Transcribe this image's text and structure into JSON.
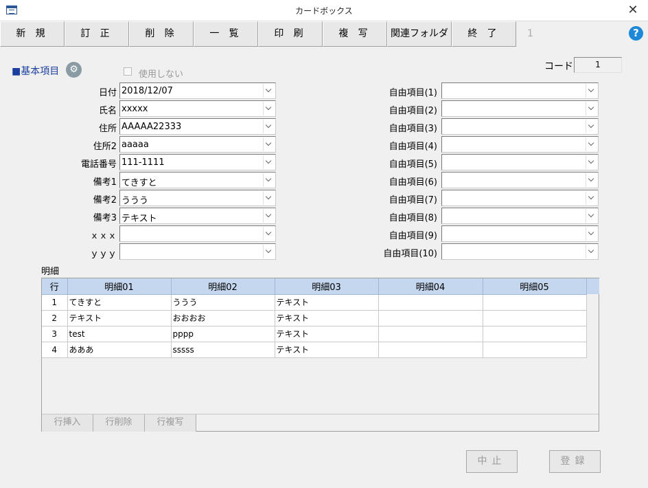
{
  "window": {
    "title": "カードボックス",
    "close_symbol": "✕"
  },
  "toolbar": {
    "buttons": [
      "新 規",
      "訂 正",
      "削 除",
      "一 覧",
      "印 刷",
      "複 写",
      "関連フォルダ",
      "終 了"
    ],
    "record_number": "1",
    "help_symbol": "?"
  },
  "section": {
    "title": "■基本項目",
    "gear_symbol": "⚙",
    "unused_label": "使用しない",
    "code_label": "コード",
    "code_value": "1"
  },
  "left_fields": [
    {
      "label": "日付",
      "value": "2018/12/07"
    },
    {
      "label": "氏名",
      "value": "xxxxx"
    },
    {
      "label": "住所",
      "value": "AAAAA22333"
    },
    {
      "label": "住所2",
      "value": "aaaaa"
    },
    {
      "label": "電話番号",
      "value": "111-1111"
    },
    {
      "label": "備考1",
      "value": "てきすと"
    },
    {
      "label": "備考2",
      "value": "ううう"
    },
    {
      "label": "備考3",
      "value": "テキスト"
    },
    {
      "label": "ｘｘｘ",
      "value": ""
    },
    {
      "label": "ｙｙｙ",
      "value": ""
    }
  ],
  "right_fields": [
    {
      "label": "自由項目(1)",
      "value": ""
    },
    {
      "label": "自由項目(2)",
      "value": ""
    },
    {
      "label": "自由項目(3)",
      "value": ""
    },
    {
      "label": "自由項目(4)",
      "value": ""
    },
    {
      "label": "自由項目(5)",
      "value": ""
    },
    {
      "label": "自由項目(6)",
      "value": ""
    },
    {
      "label": "自由項目(7)",
      "value": ""
    },
    {
      "label": "自由項目(8)",
      "value": ""
    },
    {
      "label": "自由項目(9)",
      "value": ""
    },
    {
      "label": "自由項目(10)",
      "value": ""
    }
  ],
  "detail": {
    "label": "明細",
    "headers": [
      "行",
      "明細01",
      "明細02",
      "明細03",
      "明細04",
      "明細05"
    ],
    "rows": [
      [
        "1",
        "てきすと",
        "ううう",
        "テキスト",
        "",
        ""
      ],
      [
        "2",
        "テキスト",
        "おおおお",
        "テキスト",
        "",
        ""
      ],
      [
        "3",
        "test",
        "pppp",
        "テキスト",
        "",
        ""
      ],
      [
        "4",
        "あああ",
        "sssss",
        "テキスト",
        "",
        ""
      ]
    ],
    "row_buttons": [
      "行挿入",
      "行削除",
      "行複写"
    ]
  },
  "footer": {
    "cancel_label": "中止",
    "register_label": "登録"
  }
}
